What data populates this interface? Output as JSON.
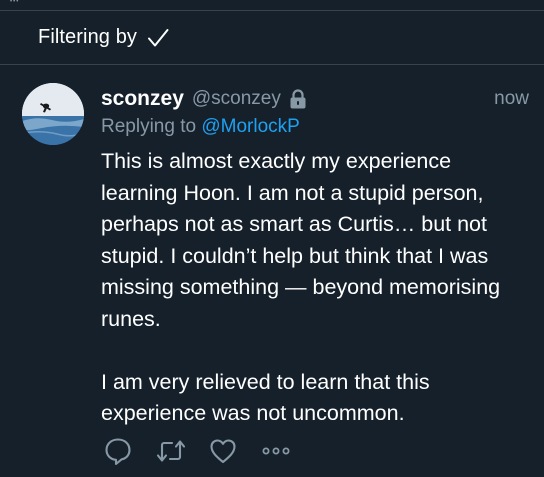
{
  "filter": {
    "label": "Filtering by"
  },
  "tweet": {
    "display_name": "sconzey",
    "handle": "@sconzey",
    "timestamp": "now",
    "reply_prefix": "Replying to",
    "reply_to": "@MorlockP",
    "paragraphs": [
      "This is almost exactly my experience learning Hoon. I am not a stupid person, perhaps not as smart as Curtis… but not stupid. I couldn’t help but think that I was missing something — beyond memorising runes.",
      "I am very relieved to learn that this experience was not uncommon."
    ]
  },
  "icons": {
    "check": "checkmark-icon",
    "lock": "lock-icon",
    "reply": "reply-icon",
    "retweet": "retweet-icon",
    "like": "heart-icon",
    "more": "more-icon"
  },
  "colors": {
    "background": "#15202b",
    "divider": "#38444d",
    "secondary_text": "#8899a6",
    "link": "#1da1f2",
    "primary_text": "#ffffff"
  }
}
